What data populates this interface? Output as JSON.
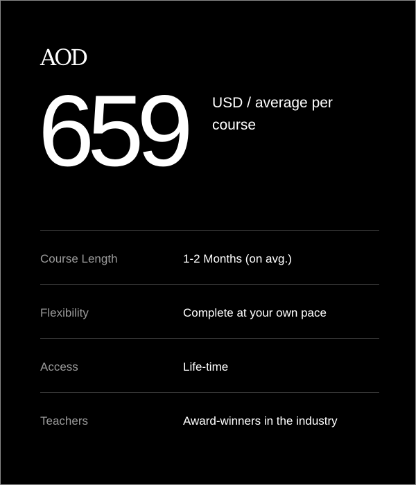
{
  "brand": {
    "logo_text": "AOD"
  },
  "price": {
    "amount": "659",
    "caption": "USD / average per course"
  },
  "specs": [
    {
      "label": "Course Length",
      "value": "1-2 Months (on avg.)"
    },
    {
      "label": "Flexibility",
      "value": "Complete at your own pace"
    },
    {
      "label": "Access",
      "value": "Life-time"
    },
    {
      "label": "Teachers",
      "value": "Award-winners in the industry"
    }
  ],
  "colors": {
    "background": "#000000",
    "text_primary": "#ffffff",
    "text_secondary": "#9a9a9a",
    "divider": "#333333"
  }
}
